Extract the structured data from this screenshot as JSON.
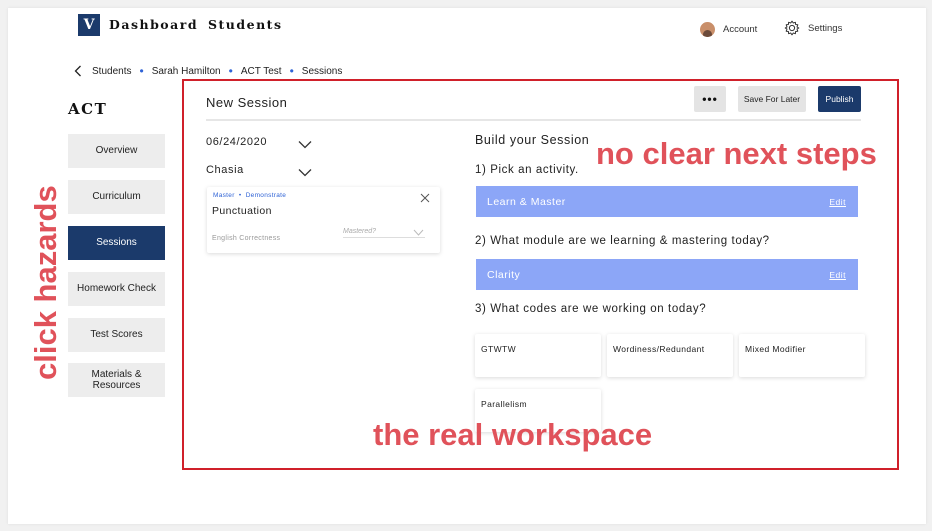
{
  "nav": {
    "logo": "V",
    "links": [
      "Dashboard",
      "Students"
    ],
    "account_label": "Account",
    "settings_label": "Settings"
  },
  "breadcrumb": [
    "Students",
    "Sarah Hamilton",
    "ACT Test",
    "Sessions"
  ],
  "sidebar": {
    "title": "ACT",
    "items": [
      {
        "label": "Overview",
        "active": false
      },
      {
        "label": "Curriculum",
        "active": false
      },
      {
        "label": "Sessions",
        "active": true
      },
      {
        "label": "Homework Check",
        "active": false
      },
      {
        "label": "Test Scores",
        "active": false
      },
      {
        "label": "Materials & Resources",
        "active": false
      }
    ]
  },
  "session": {
    "title": "New Session",
    "more_label": "•••",
    "save_label": "Save For Later",
    "publish_label": "Publish",
    "date": "06/24/2020",
    "tutor": "Chasia",
    "card": {
      "tag1": "Master",
      "tag2": "Demonstrate",
      "title": "Punctuation",
      "subtitle": "English Correctness",
      "mastered_placeholder": "Mastered?"
    }
  },
  "build": {
    "heading": "Build your Session",
    "step1": "1) Pick an activity.",
    "activity": "Learn & Master",
    "step2": "2) What module are we learning & mastering today?",
    "module": "Clarity",
    "edit_label": "Edit",
    "step3": "3) What codes are we working on today?",
    "codes": [
      "GTWTW",
      "Wordiness/Redundant",
      "Mixed Modifier",
      "Parallelism"
    ]
  },
  "annotations": {
    "next_steps": "no clear next steps",
    "workspace": "the real workspace",
    "click_hazards": "click hazards"
  },
  "colors": {
    "brand_navy": "#1b3a6b",
    "activity_blue": "#8ca6f7",
    "annotation_red": "#e0525a",
    "box_red": "#d0202a",
    "tag_blue": "#2f63d6"
  }
}
